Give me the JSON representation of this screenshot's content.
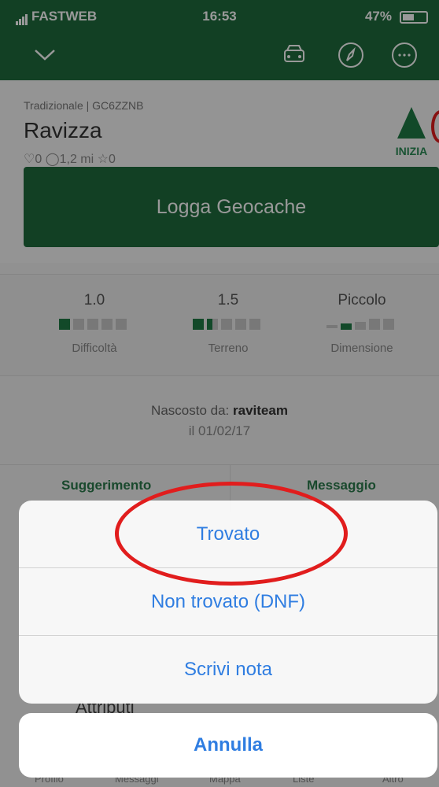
{
  "status": {
    "carrier": "FASTWEB",
    "time": "16:53",
    "battery": "47%"
  },
  "nav": {
    "icons": [
      "chevron-down-icon",
      "car-icon",
      "compass-icon",
      "more-icon"
    ]
  },
  "cache": {
    "type": "Tradizionale | GC6ZZNB",
    "name": "Ravizza",
    "stats": "♡0  ◯1,2 mi  ☆0",
    "start_label": "INIZIA"
  },
  "log_button_label": "Logga Geocache",
  "ratings": [
    {
      "value": "1.0",
      "label": "Difficoltà"
    },
    {
      "value": "1.5",
      "label": "Terreno"
    },
    {
      "value": "Piccolo",
      "label": "Dimensione"
    }
  ],
  "hidden_by": {
    "prefix": "Nascosto da:",
    "owner": "raviteam",
    "date": "il 01/02/17"
  },
  "tabs": {
    "hint": "Suggerimento",
    "message": "Messaggio"
  },
  "attributes_label": "Attributi",
  "bottom_tabs": [
    "Profilo",
    "Messaggi",
    "Mappa",
    "Liste",
    "Altro"
  ],
  "action_sheet": {
    "items": [
      "Trovato",
      "Non trovato (DNF)",
      "Scrivi nota"
    ],
    "cancel": "Annulla"
  },
  "colors": {
    "brand_green": "#1f6b3c",
    "action_blue": "#2f7de1",
    "annotation_red": "#e11d1d"
  }
}
